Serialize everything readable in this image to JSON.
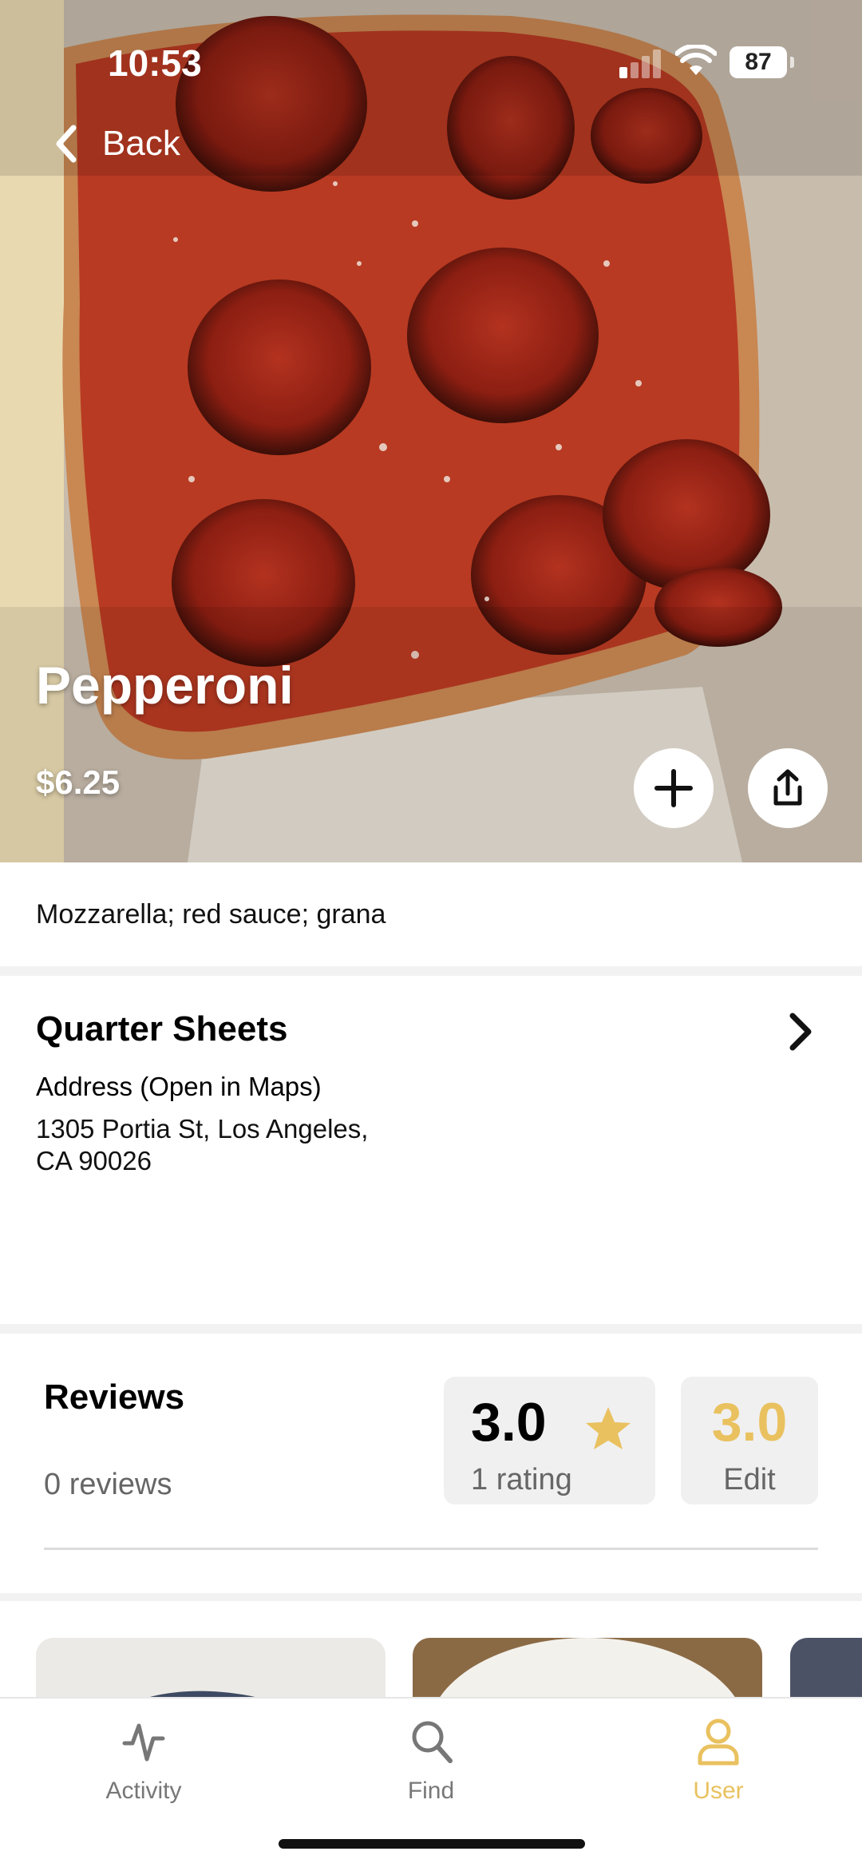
{
  "status_bar": {
    "time": "10:53",
    "battery": "87"
  },
  "nav": {
    "back_label": "Back"
  },
  "item": {
    "name": "Pepperoni",
    "price": "$6.25",
    "description": "Mozzarella; red sauce; grana"
  },
  "location": {
    "name": "Quarter Sheets",
    "address_label": "Address (Open in Maps)",
    "address_line1": "1305 Portia St, Los Angeles,",
    "address_line2": "CA 90026"
  },
  "reviews": {
    "title": "Reviews",
    "count_label": "0 reviews",
    "average": "3.0",
    "ratings_label": "1 rating",
    "user_rating": "3.0",
    "edit_label": "Edit"
  },
  "tabs": [
    {
      "label": "Activity",
      "icon": "activity-icon"
    },
    {
      "label": "Find",
      "icon": "search-icon"
    },
    {
      "label": "User",
      "icon": "user-icon"
    }
  ],
  "active_tab": "User",
  "colors": {
    "accent": "#e9c15f",
    "muted_text": "#666666",
    "separator": "#f2f2f2"
  }
}
